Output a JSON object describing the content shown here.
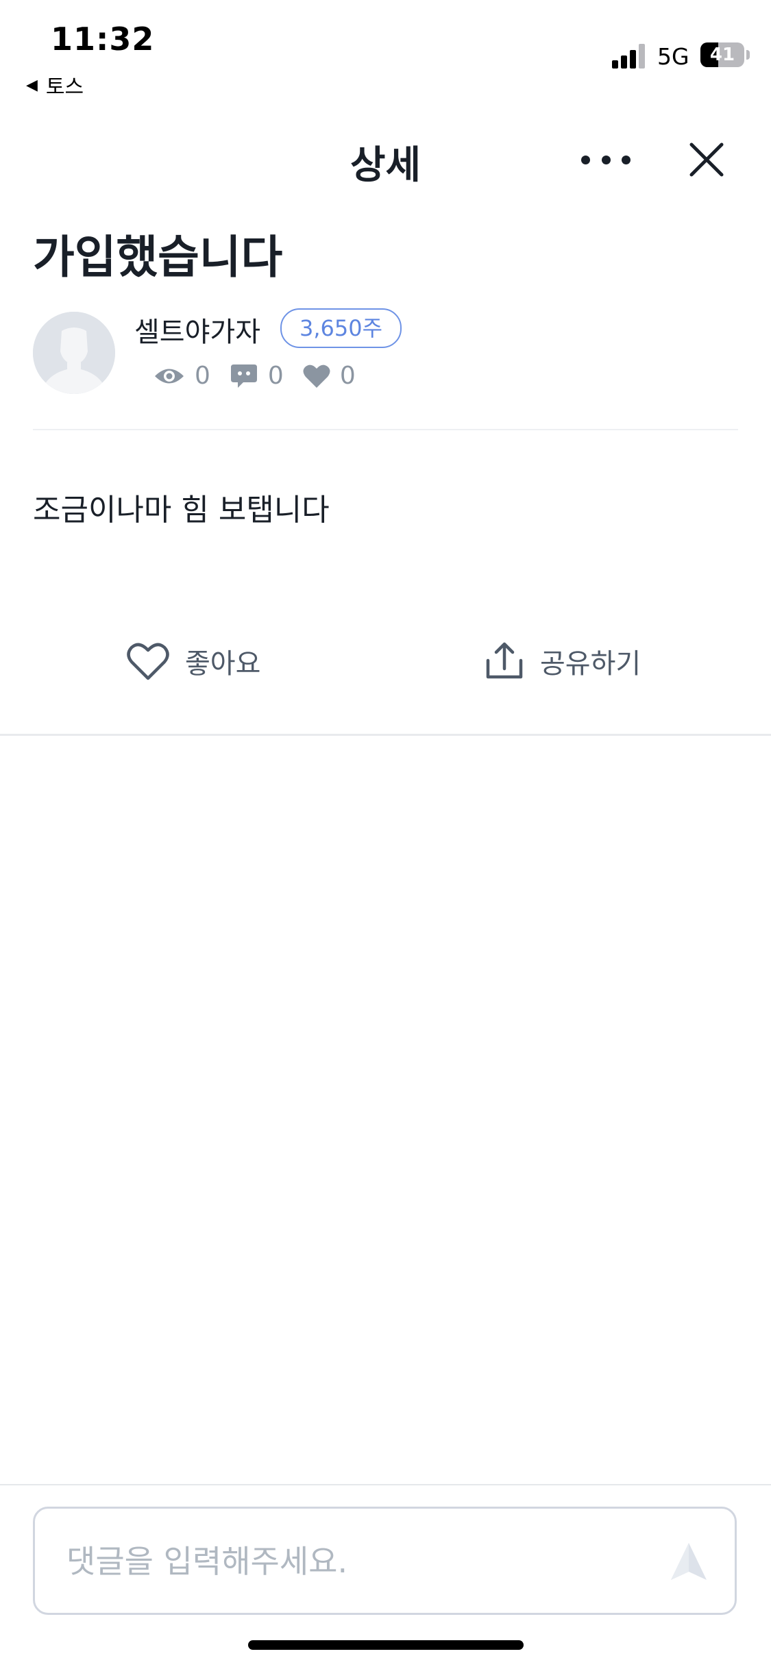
{
  "status_bar": {
    "time": "11:32",
    "back_app": "토스",
    "network": "5G",
    "battery": "41",
    "battery_level_percent": 41
  },
  "header": {
    "title": "상세",
    "more_icon": "more-horizontal-icon",
    "close_icon": "close-icon"
  },
  "post": {
    "title": "가입했습니다",
    "author": "셀트야가자",
    "shares": "3,650주",
    "views": "0",
    "comments": "0",
    "likes": "0",
    "body": "조금이나마 힘 보탭니다"
  },
  "actions": {
    "like_label": "좋아요",
    "share_label": "공유하기"
  },
  "comment": {
    "placeholder": "댓글을 입력해주세요.",
    "value": ""
  },
  "colors": {
    "accent": "#5d85e0",
    "text_primary": "#191f28",
    "text_secondary": "#8b95a1",
    "divider": "#e5e8eb"
  }
}
